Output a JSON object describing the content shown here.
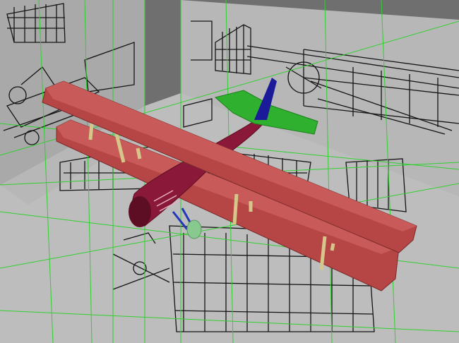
{
  "viewport": {
    "colors": {
      "background": "#6f6f6f",
      "floor": "#bdbdbd",
      "side_plane": "#a9a9a9",
      "back_plane": "#b7b7b7",
      "wireframe": "#30d030",
      "blueprint_ink": "#141414",
      "wing_red": "#b64646",
      "wing_red_light": "#c95a5a",
      "wing_edge": "#7a2a2a",
      "fuselage": "#8a1838",
      "fuselage_dark": "#5e0e24",
      "strut": "#d6c68a",
      "tail_green": "#2fb02f",
      "tail_blue": "#1b1b9a",
      "wheel": "#88c98f",
      "landing_gear": "#2238b8"
    },
    "objects": {
      "floor": "floor-blueprint-plane",
      "side": "side-blueprint-plane",
      "back": "back-blueprint-plane",
      "model": "biplane-model"
    }
  }
}
